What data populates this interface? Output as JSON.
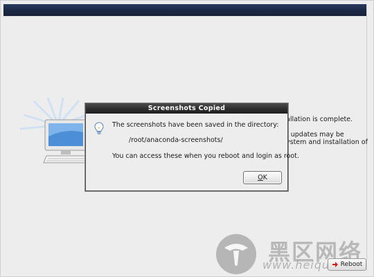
{
  "background": {
    "line1": "allation is complete.",
    "line2": "t updates may be",
    "line3": "ystem and installation of",
    "reboot_label": "Reboot"
  },
  "dialog": {
    "title": "Screenshots Copied",
    "message": "The screenshots have been saved in the directory:",
    "path": "/root/anaconda-screenshots/",
    "access_note": "You can access these when you reboot and login as root.",
    "ok_mnemonic": "O",
    "ok_rest": "K"
  },
  "watermark": {
    "chinese": "黑区网络",
    "url": "www.heiqu.com"
  },
  "colors": {
    "titlebar": "#2c2c2c",
    "banner": "#1b2845",
    "window_bg": "#ededed"
  }
}
